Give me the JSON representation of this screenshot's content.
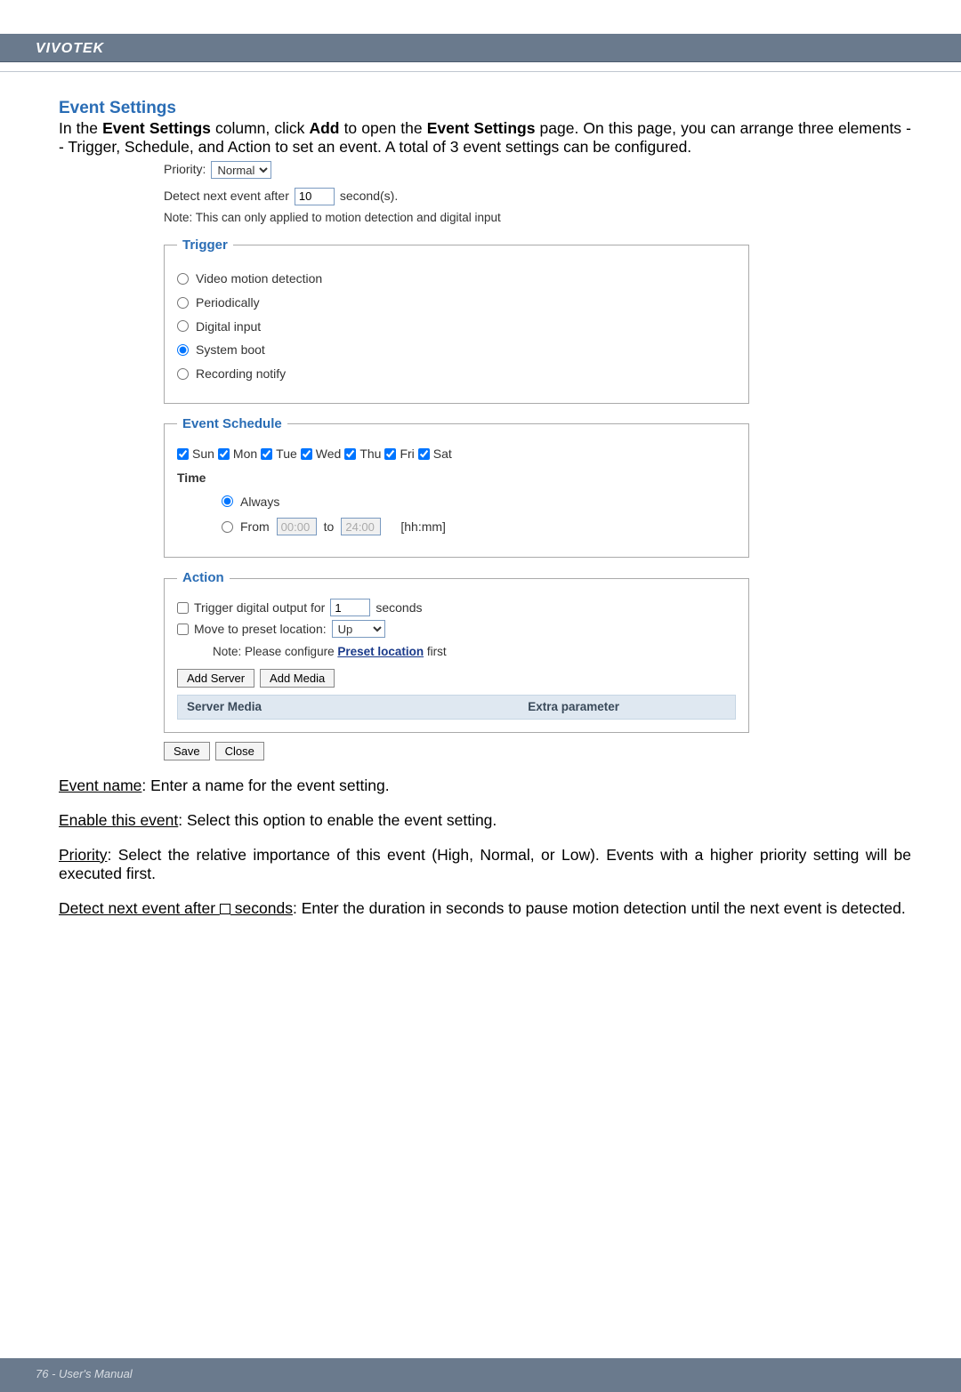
{
  "header_brand": "VIVOTEK",
  "footer_text": "76 - User's Manual",
  "section_title": "Event Settings",
  "intro_prefix": "In the ",
  "intro_bold1": "Event Settings",
  "intro_mid1": " column, click ",
  "intro_bold2": "Add",
  "intro_mid2": " to open the ",
  "intro_bold3": "Event Settings",
  "intro_mid3": " page. On this page, you can arrange three elements -- Trigger, Schedule, and Action to set an event. A total of 3 event settings can be configured.",
  "form": {
    "priority_label": "Priority:",
    "priority_value": "Normal",
    "detect_label_pre": "Detect next event after",
    "detect_value": "10",
    "detect_label_post": "second(s).",
    "note_text": "Note: This can only applied to motion detection and digital input",
    "trigger": {
      "legend": "Trigger",
      "opt_video": "Video motion detection",
      "opt_periodic": "Periodically",
      "opt_digital": "Digital input",
      "opt_boot": "System boot",
      "opt_recnotify": "Recording notify"
    },
    "schedule": {
      "legend": "Event Schedule",
      "day_sun": "Sun",
      "day_mon": "Mon",
      "day_tue": "Tue",
      "day_wed": "Wed",
      "day_thu": "Thu",
      "day_fri": "Fri",
      "day_sat": "Sat",
      "time_label": "Time",
      "opt_always": "Always",
      "opt_from": "From",
      "from_val": "00:00",
      "to_label": "to",
      "to_val": "24:00",
      "hhmm": "[hh:mm]"
    },
    "action": {
      "legend": "Action",
      "trigger_digital_pre": "Trigger digital output for",
      "trigger_digital_val": "1",
      "trigger_digital_post": "seconds",
      "move_preset_label": "Move to preset location:",
      "move_preset_val": "Up",
      "note_pre": "Note: Please configure ",
      "note_link": "Preset location",
      "note_post": " first",
      "btn_add_server": "Add Server",
      "btn_add_media": "Add Media",
      "srv_label": "Server Media",
      "extra_label": "Extra parameter"
    },
    "btn_save": "Save",
    "btn_close": "Close"
  },
  "desc": {
    "event_name_u": "Event name",
    "event_name_t": ": Enter a name for the event setting.",
    "enable_u": "Enable this event",
    "enable_t": ": Select this option to enable the event setting.",
    "priority_u": "Priority",
    "priority_t": ": Select the relative importance of this event (High, Normal, or Low). Events with a higher priority setting will be executed first.",
    "detect_u_pre": "Detect next event after ",
    "detect_u_post": " seconds",
    "detect_t": ": Enter the duration in seconds to pause motion detection until the next event is detected."
  }
}
